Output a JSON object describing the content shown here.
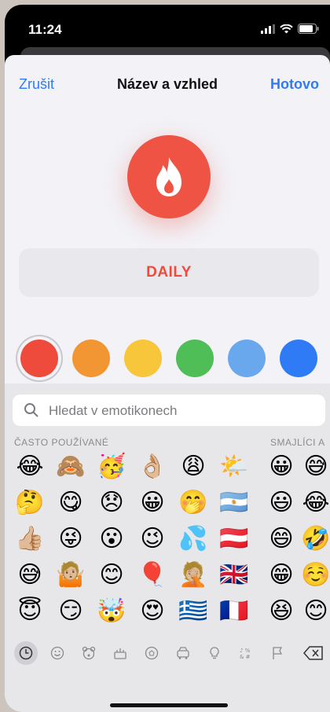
{
  "status": {
    "time": "11:24"
  },
  "nav": {
    "cancel": "Zrušit",
    "title": "Název a vzhled",
    "done": "Hotovo"
  },
  "icon": {
    "name": "flame-icon",
    "color": "#ef5344"
  },
  "name_field": {
    "value": "DAILY"
  },
  "colors": [
    "#ef4b3c",
    "#f29533",
    "#f7c63b",
    "#4fbe57",
    "#6aa8ee",
    "#2f7bf6"
  ],
  "selected_color": "#ef4b3c",
  "keyboard": {
    "search_placeholder": "Hledat v emotikonech",
    "section_frequent": "ČASTO POUŽÍVANÉ",
    "section_smileys": "SMAJLÍCI A",
    "frequent": [
      "😂",
      "🙈",
      "🥳",
      "👌🏼",
      "😩",
      "🌤️",
      "🤔",
      "😋",
      "😞",
      "😀",
      "🤭",
      "🇦🇷",
      "👍🏼",
      "😜",
      "😮",
      "😉",
      "💦",
      "🇦🇹",
      "😅",
      "🤷🏼",
      "😊",
      "🎈",
      "🤦🏼",
      "🇬🇧",
      "😇",
      "😏",
      "🤯",
      "😍",
      "🇬🇷",
      "🇫🇷"
    ],
    "smileys": [
      "😀",
      "😅",
      "😃",
      "😂",
      "😄",
      "🤣",
      "😁",
      "☺️",
      "😆",
      "😊"
    ],
    "categories": [
      "clock-icon",
      "smiley-icon",
      "bear-icon",
      "food-icon",
      "ball-icon",
      "car-icon",
      "bulb-icon",
      "symbols-icon",
      "flag-icon",
      "backspace-icon"
    ]
  }
}
